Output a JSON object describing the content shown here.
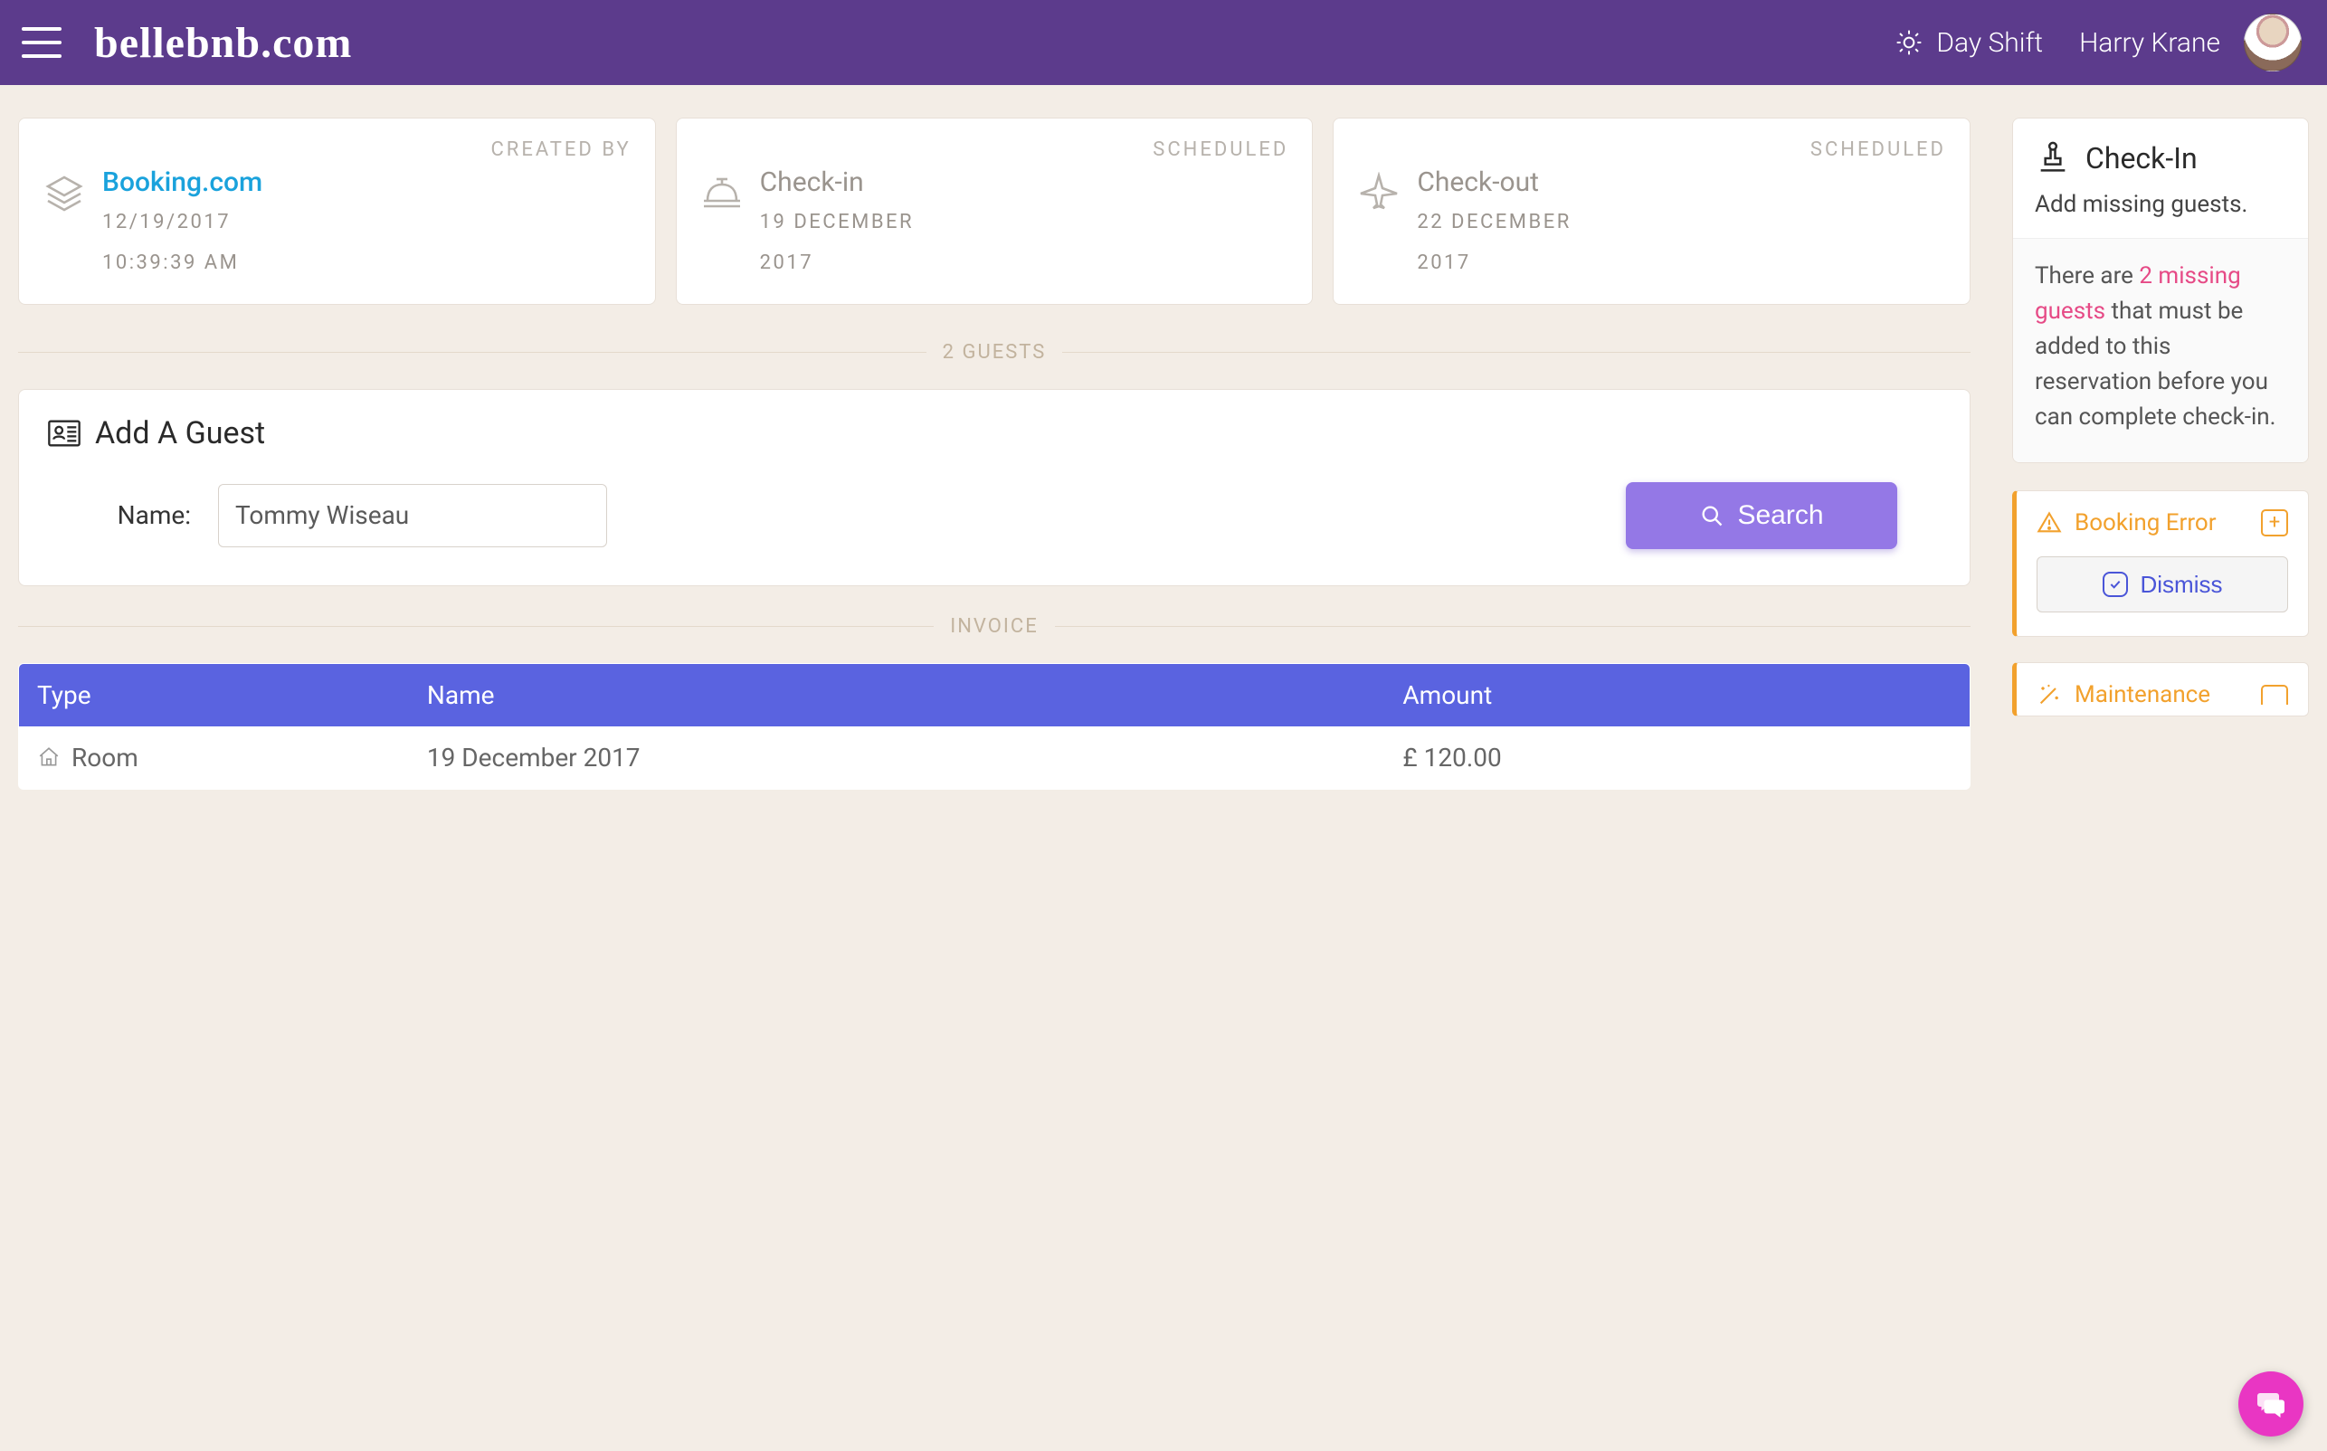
{
  "header": {
    "logo": "bellebnb.com",
    "shift_label": "Day Shift",
    "username": "Harry Krane"
  },
  "cards": {
    "created": {
      "eyebrow": "CREATED BY",
      "source": "Booking.com",
      "date": "12/19/2017",
      "time": "10:39:39 AM"
    },
    "checkin": {
      "eyebrow": "SCHEDULED",
      "title": "Check-in",
      "date_line1": "19 DECEMBER",
      "date_line2": "2017"
    },
    "checkout": {
      "eyebrow": "SCHEDULED",
      "title": "Check-out",
      "date_line1": "22 DECEMBER",
      "date_line2": "2017"
    }
  },
  "sections": {
    "guests_heading": "2 GUESTS",
    "invoice_heading": "INVOICE"
  },
  "add_guest": {
    "title": "Add A Guest",
    "name_label": "Name:",
    "name_value": "Tommy Wiseau",
    "search_label": "Search"
  },
  "invoice": {
    "headers": {
      "type": "Type",
      "name": "Name",
      "amount": "Amount"
    },
    "rows": [
      {
        "type": "Room",
        "name": "19 December 2017",
        "amount": "£ 120.00"
      }
    ]
  },
  "sidebar": {
    "checkin": {
      "title": "Check-In",
      "subtitle": "Add missing guests.",
      "msg_prefix": "There are ",
      "msg_highlight": "2 missing guests",
      "msg_suffix": " that must be added to this reservation before you can complete check-in."
    },
    "booking_error": {
      "title": "Booking Error",
      "dismiss": "Dismiss"
    },
    "maintenance": {
      "title": "Maintenance"
    }
  }
}
